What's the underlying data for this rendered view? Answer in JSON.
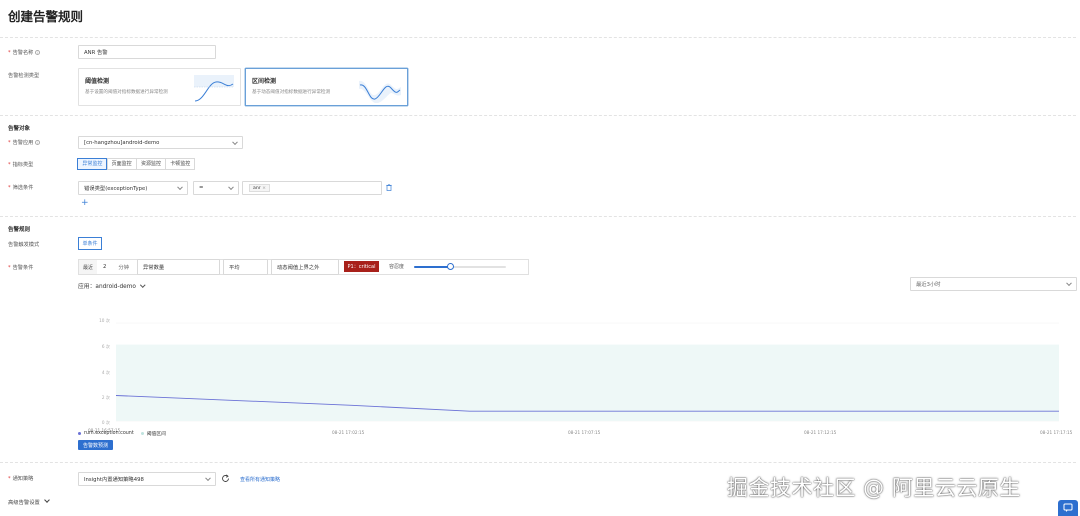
{
  "page": {
    "title": "创建告警规则"
  },
  "basic": {
    "name_label": "告警名称",
    "name_value": "ANR 告警",
    "type_label": "告警检测类型",
    "cards": [
      {
        "title": "阈值检测",
        "desc": "基于设置的阈值对指标数据进行异常检测",
        "selected": false
      },
      {
        "title": "区间检测",
        "desc": "基于动态阈值对指标数据进行异常检测",
        "selected": true
      }
    ]
  },
  "target": {
    "section": "告警对象",
    "app_label": "告警应用",
    "app_value": "[cn-hangzhou]android-demo",
    "metric_label": "指标类型",
    "metric_tabs": [
      "异常监控",
      "页面监控",
      "资源监控",
      "卡顿监控"
    ],
    "metric_active": 0,
    "filter_label": "筛选条件",
    "filter_field": "错误类型(exceptionType)",
    "filter_op": "=",
    "filter_tag": "anr",
    "filter_tag_close": "×",
    "add_icon": "+",
    "delete_icon": "trash-icon"
  },
  "rule": {
    "section": "告警规则",
    "trigger_label": "告警触发模式",
    "trigger_value": "单条件",
    "cond_label": "告警条件",
    "recent_label": "最近",
    "recent_value": "2",
    "unit": "分钟",
    "metric": "异常数量",
    "agg": "平均",
    "compare": "动态阈值上界之外",
    "level": "P1：critical",
    "tolerance_label": "容忍度",
    "tolerance_value": 0.4
  },
  "chart_header": {
    "app_prefix": "应用：",
    "app_name": "android-demo",
    "range": "最近3小时"
  },
  "chart_data": {
    "type": "line",
    "y_ticks": [
      "10 次",
      "6 次",
      "4 次",
      "2 次",
      "0 次"
    ],
    "x_ticks": [
      "08-21 16:57:15",
      "08-21 17:02:15",
      "08-21 17:07:15",
      "08-21 17:12:15",
      "08-21 17:17:15"
    ],
    "series": [
      {
        "name": "rum.exception.count",
        "values": [
          2.6,
          2.1,
          1.6,
          1.0,
          1.0,
          1.0,
          1.0,
          1.0,
          1.0
        ]
      }
    ],
    "band": {
      "name": "阈值区间",
      "lower": 0,
      "upper": 7.8
    },
    "ylim": [
      0,
      10
    ],
    "colors": {
      "line": "#6b72d6",
      "band": "#eef8f7"
    }
  },
  "chart_footer": {
    "preview_button": "告警数预测"
  },
  "notify": {
    "label": "通知策略",
    "value": "Insight内置通知策略498",
    "refresh_icon": "refresh-icon",
    "link": "查看所有通知策略",
    "advanced": "高级告警设置"
  },
  "watermark": "掘金技术社区 @ 阿里云云原生"
}
